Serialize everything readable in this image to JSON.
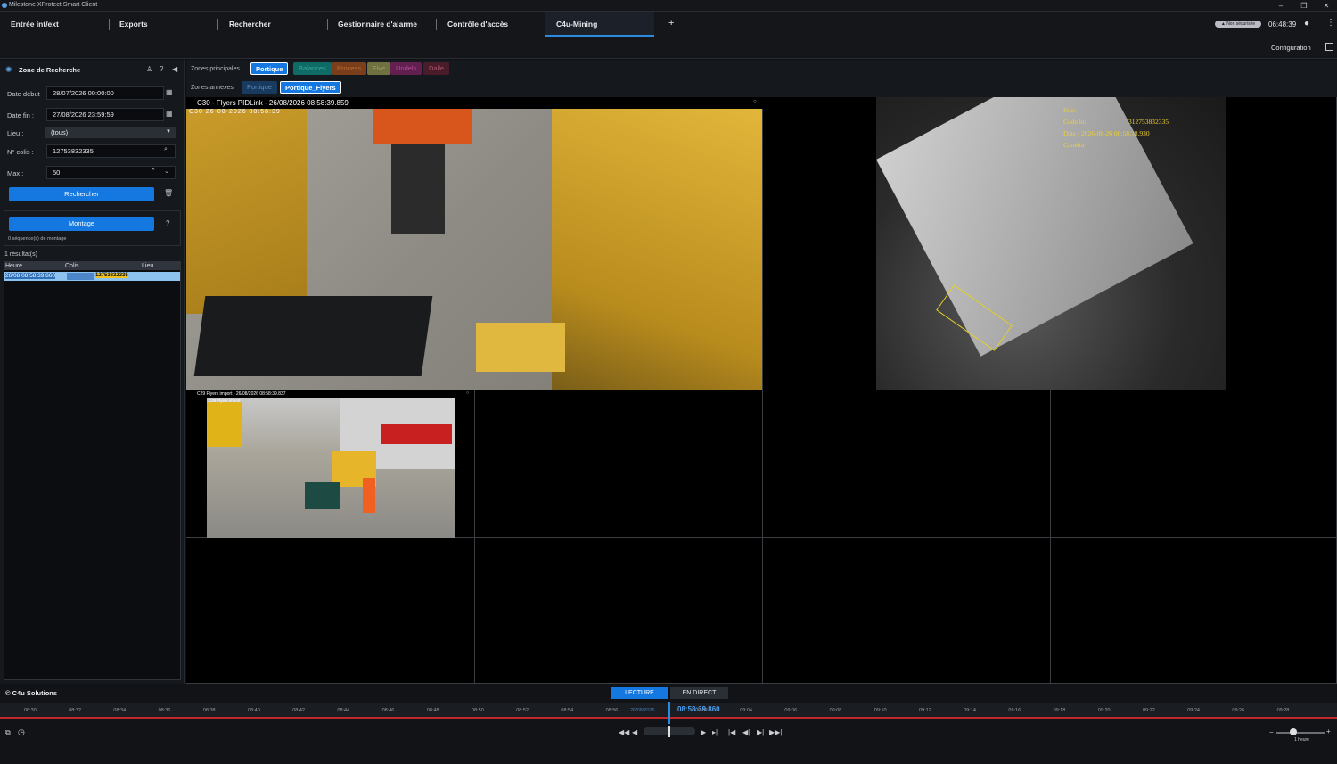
{
  "window": {
    "title": "Milestone XProtect Smart Client",
    "minimize": "–",
    "restore": "❐",
    "close": "✕"
  },
  "tabs": [
    "Entrée int/ext",
    "Exports",
    "Rechercher",
    "Gestionnaire d'alarme",
    "Contrôle d'accès",
    "C4u-Mining"
  ],
  "add_tab": "+",
  "header": {
    "security_badge": "Non sécurisée",
    "clock": "06:48:39",
    "configuration": "Configuration"
  },
  "search": {
    "title": "Zone de Recherche",
    "date_start_label": "Date début",
    "date_start": "28/07/2026 00:00:00",
    "date_end_label": "Date fin :",
    "date_end": "27/08/2026 23:59:59",
    "lieu_label": "Lieu :",
    "lieu_value": "(tous)",
    "colis_label": "N° colis :",
    "colis_value": "12753832335",
    "max_label": "Max :",
    "max_value": "50",
    "search_button": "Rechercher",
    "montage_button": "Montage",
    "help": "?",
    "montage_count": "0 séquence(s) de montage",
    "results_count": "1 résultat(s)",
    "columns": [
      "Heure",
      "Colis",
      "Lieu"
    ],
    "rows": [
      {
        "heure": "26/08 08:58:39.860",
        "colis": "12753832335",
        "lieu": ""
      }
    ]
  },
  "zones": {
    "main_label": "Zones principales",
    "main": [
      "Portique",
      "Balances",
      "Process",
      "Five",
      "Undels",
      "Dalle"
    ],
    "annex_label": "Zones annexes",
    "annex": [
      "Portique",
      "Portique_Flyers"
    ]
  },
  "cameras": {
    "main_title": "C30 - Flyers PIDLink - 26/08/2026 08:58:39.859",
    "main_overlay": "C30      26-08-2026 08:58:39",
    "scanner_overlay": {
      "site": "Site:",
      "code_label": "Code lu:",
      "code": "312753832335",
      "date": "Date : 2026-08-26 08:58:38.930",
      "camera": "Caméra :"
    },
    "small_title": "C29 Flyers import - 26/08/2026 08:58:39.837",
    "small_overlay": "C29 Flyers import"
  },
  "footer": {
    "copyright": "© C4u Solutions",
    "mode_playback": "LECTURE",
    "mode_live": "EN DIRECT",
    "current_time": "08:58:39.860",
    "current_date": "26/08/2026",
    "ticks": [
      "08:30",
      "08:32",
      "08:34",
      "08:36",
      "08:38",
      "08:40",
      "08:42",
      "08:44",
      "08:46",
      "08:48",
      "08:50",
      "08:52",
      "08:54",
      "08:56",
      "26/08/2026",
      "09:02",
      "09:04",
      "09:06",
      "09:08",
      "09:10",
      "09:12",
      "09:14",
      "09:16",
      "09:18",
      "09:20",
      "09:22",
      "09:24",
      "09:26",
      "09:28"
    ],
    "zoom_label": "1 heure",
    "colors": {
      "accent": "#1478e0",
      "timeline_red": "#c0282a"
    }
  }
}
